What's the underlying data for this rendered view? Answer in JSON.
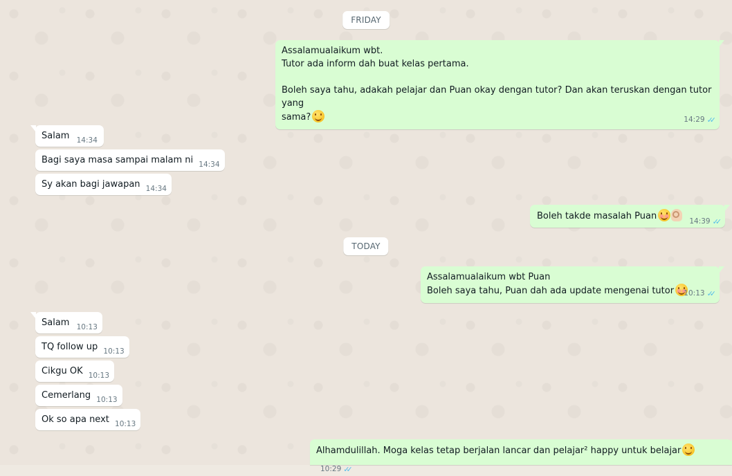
{
  "chat": {
    "dates": {
      "friday": "FRIDAY",
      "today": "TODAY"
    },
    "messages": [
      {
        "text": "Assalamualaikum wbt.\nTutor ada inform dah buat kelas pertama.\n\nBoleh saya tahu, adakah pelajar dan Puan okay dengan tutor? Dan akan teruskan dengan tutor yang\nsama?",
        "time": "14:29",
        "direction": "outgoing",
        "emoji": "smiling-face-icon"
      },
      {
        "text": "Salam",
        "time": "14:34",
        "direction": "incoming"
      },
      {
        "text": "Bagi saya masa sampai malam ni",
        "time": "14:34",
        "direction": "incoming"
      },
      {
        "text": "Sy akan bagi jawapan",
        "time": "14:34",
        "direction": "incoming"
      },
      {
        "text": "Boleh takde masalah Puan",
        "time": "14:39",
        "direction": "outgoing",
        "emoji": "blush-face-icon ok-hand-icon"
      },
      {
        "text": "Assalamualaikum wbt Puan\nBoleh saya tahu, Puan dah ada update mengenai tutor",
        "time": "10:13",
        "direction": "outgoing",
        "emoji": "blush-face-icon"
      },
      {
        "text": "Salam",
        "time": "10:13",
        "direction": "incoming"
      },
      {
        "text": "TQ follow up",
        "time": "10:13",
        "direction": "incoming"
      },
      {
        "text": "Cikgu OK",
        "time": "10:13",
        "direction": "incoming"
      },
      {
        "text": "Cemerlang",
        "time": "10:13",
        "direction": "incoming"
      },
      {
        "text": "Ok so apa next",
        "time": "10:13",
        "direction": "incoming"
      },
      {
        "text": "Alhamdulillah. Moga kelas tetap berjalan lancar dan pelajar² happy untuk belajar",
        "time": "10:29",
        "direction": "outgoing",
        "emoji": "smiling-face-icon"
      }
    ],
    "read_ticks": "✓✓",
    "colors": {
      "outgoing_bubble": "#d9fdd3",
      "incoming_bubble": "#ffffff",
      "read_tick": "#53bdeb",
      "background": "#efeae2"
    }
  }
}
